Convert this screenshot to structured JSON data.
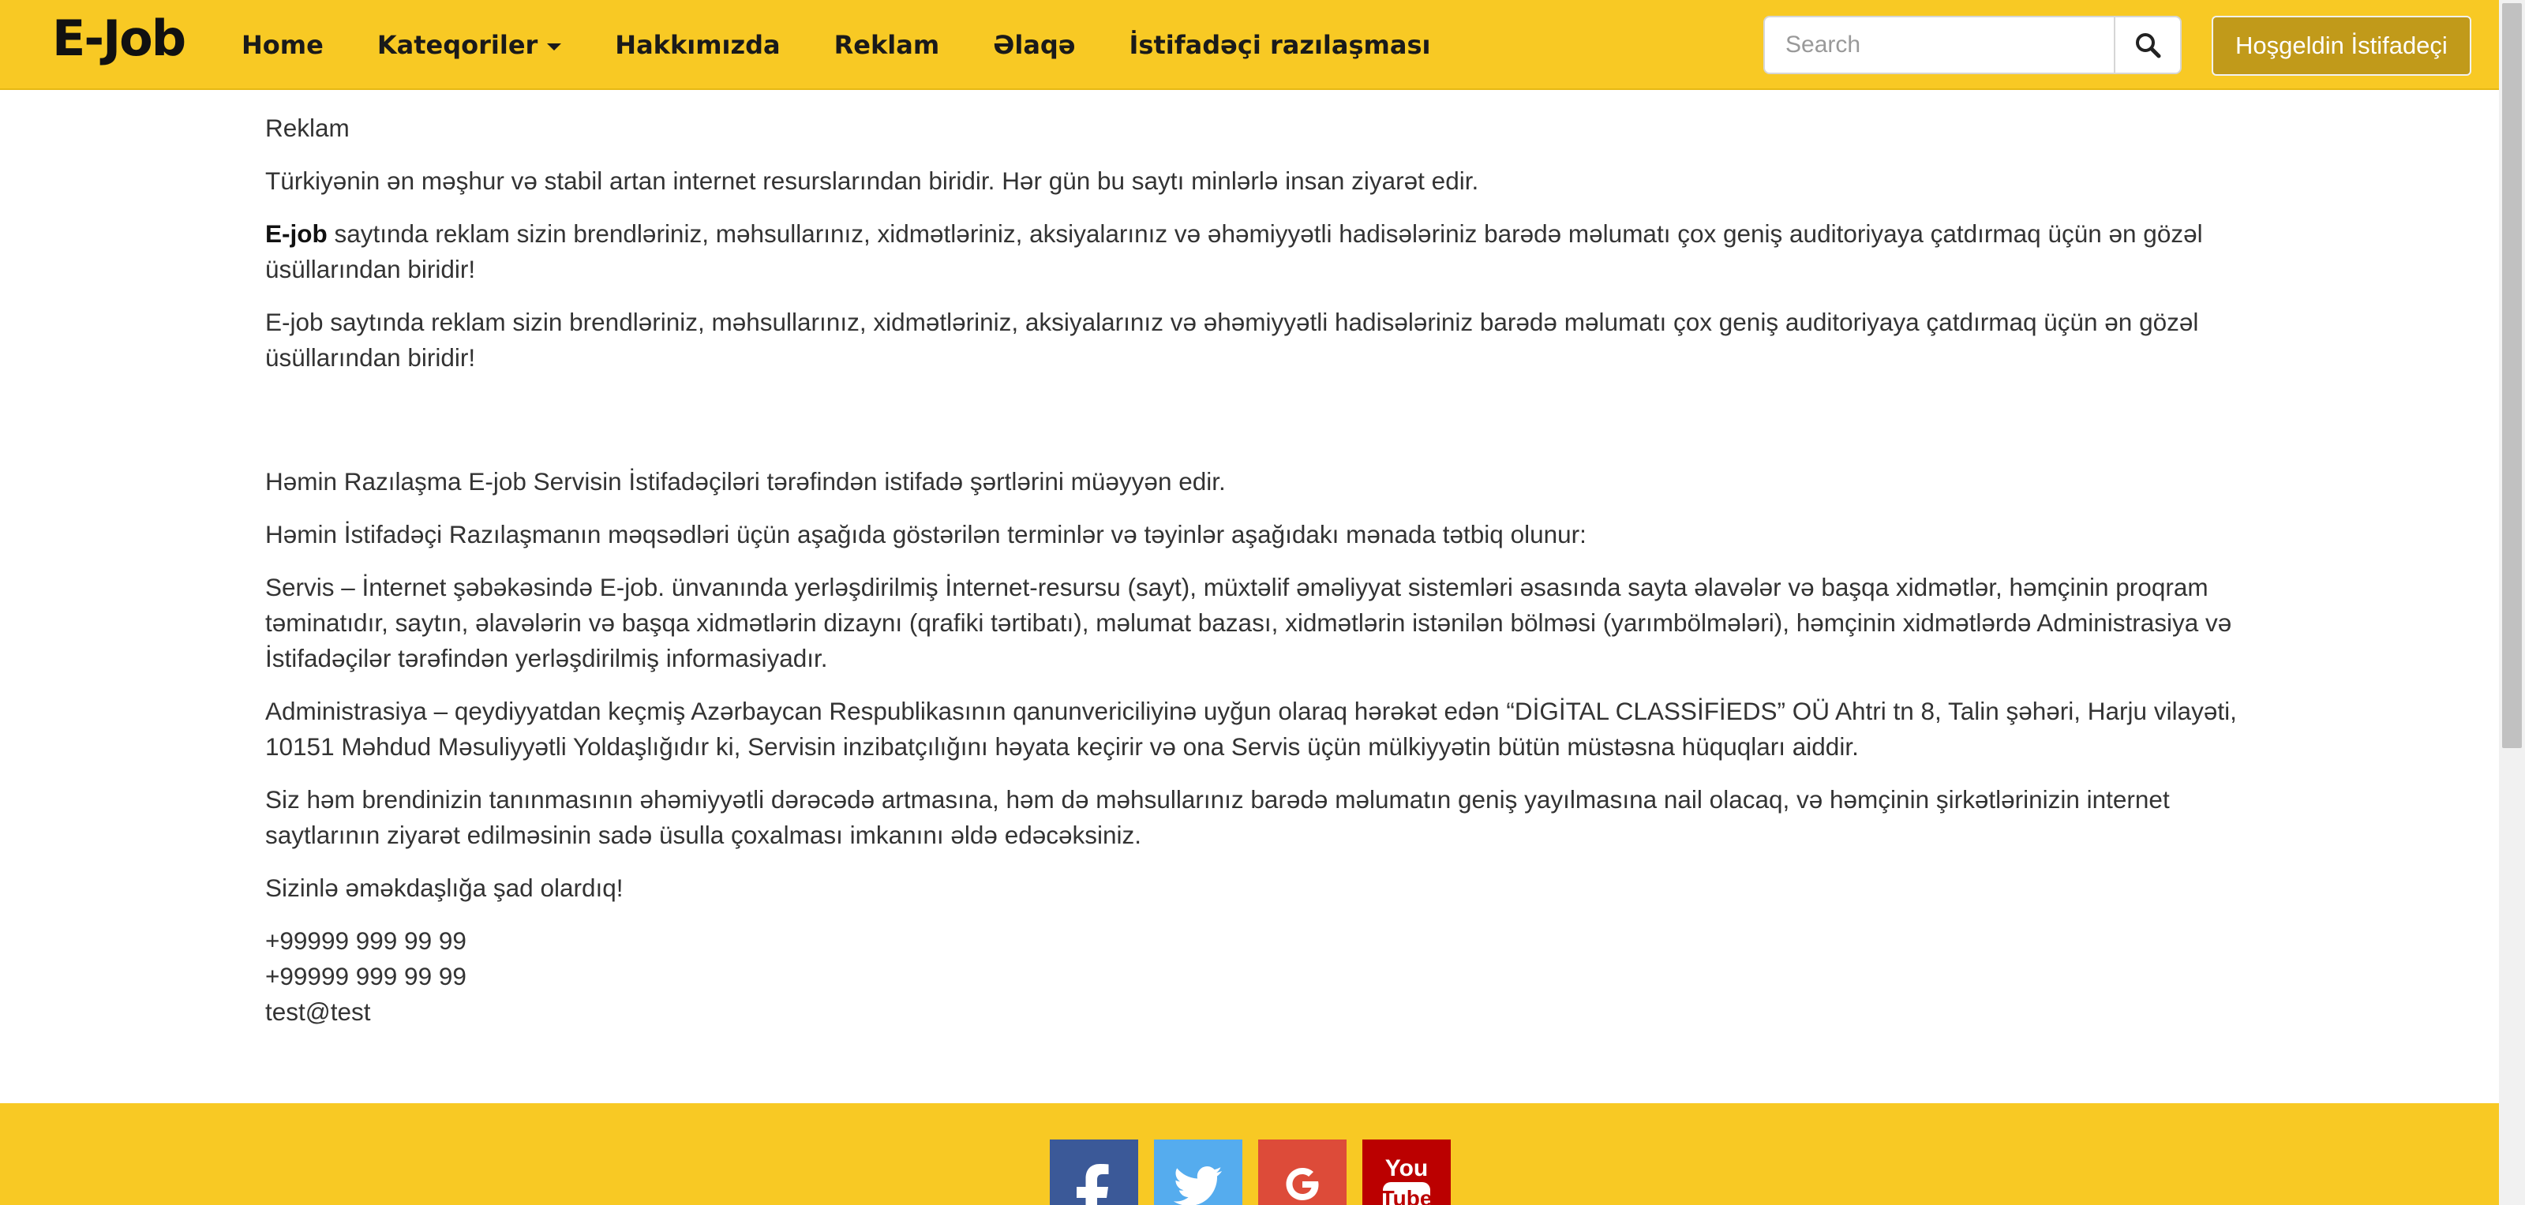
{
  "navbar": {
    "brand": "E-Job",
    "links": [
      {
        "label": "Home"
      },
      {
        "label": "Kateqoriler"
      },
      {
        "label": "Hakkımızda"
      },
      {
        "label": "Reklam"
      },
      {
        "label": "Əlaqə"
      },
      {
        "label": "İstifadəçi razılaşması"
      }
    ],
    "search": {
      "placeholder": "Search",
      "value": ""
    },
    "search_icon": "search-icon",
    "welcome_label": "Hoşgeldin İstifadeçi",
    "color": "#f8c924"
  },
  "content": {
    "title": "Reklam",
    "p1": "Türkiyənin ən məşhur və stabil artan internet resurslarından biridir. Hər gün bu saytı minlərlə insan ziyarət edir.",
    "p2_bold": "E-job",
    "p2_rest": " saytında reklam sizin brendləriniz, məhsullarınız, xidmətləriniz, aksiyalarınız və əhəmiyyətli hadisələriniz barədə məlumatı çox geniş auditoriyaya çatdırmaq üçün ən gözəl üsüllarından biridir!",
    "p3": "E-job saytında reklam sizin brendləriniz, məhsullarınız, xidmətləriniz, aksiyalarınız və əhəmiyyətli hadisələriniz barədə məlumatı çox geniş auditoriyaya çatdırmaq üçün ən gözəl üsüllarından biridir!",
    "p4": "Həmin Razılaşma E-job Servisin İstifadəçiləri tərəfindən istifadə şərtlərini müəyyən edir.",
    "p5": "Həmin İstifadəçi Razılaşmanın məqsədləri üçün aşağıda göstərilən terminlər və təyinlər aşağıdakı mənada tətbiq olunur:",
    "p6": "Servis – İnternet şəbəkəsində E-job. ünvanında yerləşdirilmiş İnternet-resursu (sayt), müxtəlif əməliyyat sistemləri əsasında sayta əlavələr və başqa xidmətlər, həmçinin proqram təminatıdır, saytın, əlavələrin və başqa xidmətlərin dizaynı (qrafiki tərtibatı), məlumat bazası, xidmətlərin istənilən bölməsi (yarımbölmələri), həmçinin xidmətlərdə Administrasiya və İstifadəçilər tərəfindən yerləşdirilmiş informasiyadır.",
    "p7": "Administrasiya – qeydiyyatdan keçmiş Azərbaycan Respublikasının qanunvericiliyinə uyğun olaraq hərəkət edən “DİGİTAL CLASSİFİEDS” OÜ Ahtri tn 8, Talin şəhəri, Harju vilayəti, 10151 Məhdud Məsuliyyətli Yoldaşlığıdır ki, Servisin inzibatçılığını həyata keçirir və ona Servis üçün mülkiyyətin bütün müstəsna hüquqları aiddir.",
    "p8": "Siz həm brendinizin tanınmasının əhəmiyyətli dərəcədə artmasına, həm də məhsullarınız barədə məlumatın geniş yayılmasına nail olacaq, və həmçinin şirkətlərinizin internet saytlarının ziyarət edilməsinin sadə üsulla çoxalması imkanını əldə edəcəksiniz.",
    "p9": "Sizinlə əməkdaşlığa şad olardıq!",
    "phone1": "+99999 999 99 99",
    "phone2": "+99999 999 99 99",
    "email": "test@test"
  },
  "footer": {
    "social": [
      {
        "icon": "facebook-icon",
        "glyph": "f",
        "color": "#3b5998"
      },
      {
        "icon": "twitter-icon",
        "color": "#55acee"
      },
      {
        "icon": "google-icon",
        "glyph": "G",
        "color": "#dd4b39"
      },
      {
        "icon": "youtube-icon",
        "glyph": "You Tube",
        "color": "#bb0000"
      }
    ]
  }
}
